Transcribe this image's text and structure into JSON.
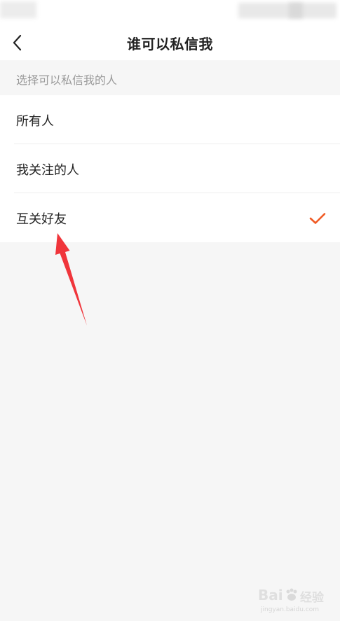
{
  "header": {
    "title": "谁可以私信我",
    "back_icon": "chevron-left-icon"
  },
  "section": {
    "header": "选择可以私信我的人"
  },
  "options": [
    {
      "label": "所有人",
      "selected": false
    },
    {
      "label": "我关注的人",
      "selected": false
    },
    {
      "label": "互关好友",
      "selected": true
    }
  ],
  "colors": {
    "accent": "#f05a24",
    "annotation_arrow": "#f0353b"
  },
  "watermark": {
    "brand": "Bai",
    "brand_suffix": "经验",
    "url": "jingyan.baidu.com"
  }
}
